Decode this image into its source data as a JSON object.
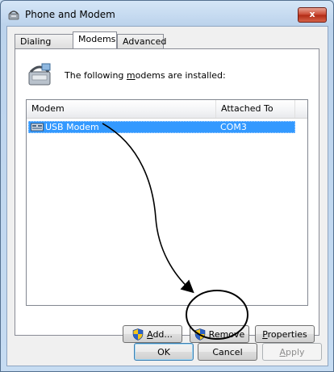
{
  "window": {
    "title": "Phone and Modem",
    "close_label": "x"
  },
  "tabs": [
    {
      "label": "Dialing Rules",
      "active": false
    },
    {
      "label": "Modems",
      "active": true
    },
    {
      "label": "Advanced",
      "active": false
    }
  ],
  "panel": {
    "intro_before": "The following ",
    "intro_mnemonic": "m",
    "intro_after": "odems are installed:"
  },
  "modem_list": {
    "columns": [
      "Modem",
      "Attached To"
    ],
    "rows": [
      {
        "modem": "USB Modem",
        "attached_to": "COM3",
        "selected": true
      }
    ]
  },
  "panel_buttons": {
    "add": {
      "mnemonic": "A",
      "rest": "dd..."
    },
    "remove": {
      "mnemonic": "R",
      "rest": "emove"
    },
    "properties": {
      "mnemonic": "P",
      "rest": "roperties"
    }
  },
  "dialog_buttons": {
    "ok": "OK",
    "cancel": "Cancel",
    "apply_mnemonic": "A",
    "apply_rest": "pply"
  },
  "colors": {
    "selection": "#3399ff",
    "window_frame": "#c6dcf2",
    "annotation": "#000000"
  }
}
